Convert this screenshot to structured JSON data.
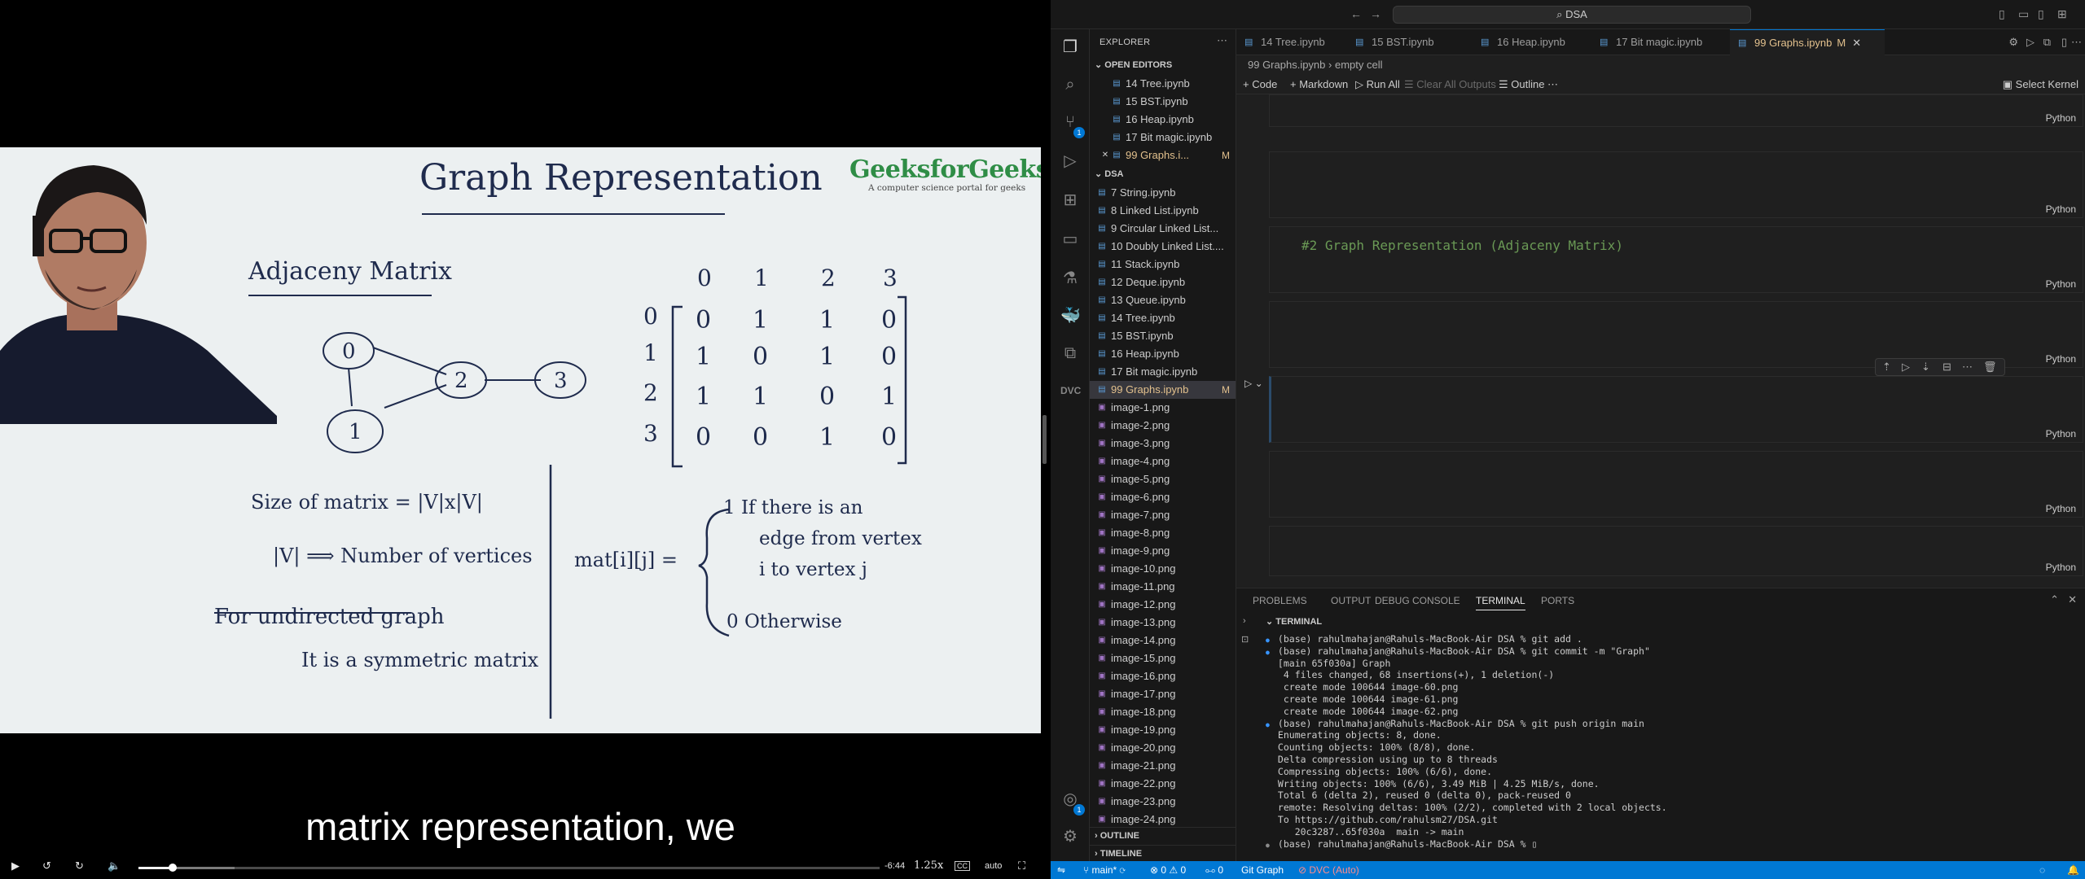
{
  "video": {
    "whiteboard": {
      "title": "Graph Representation",
      "logo": "GeeksforGeeks",
      "logo_tagline": "A computer science portal for geeks",
      "section": "Adjaceny Matrix",
      "graph_nodes": [
        "0",
        "1",
        "2",
        "3"
      ],
      "matrix_col_headers": [
        "0",
        "1",
        "2",
        "3"
      ],
      "matrix_row_headers": [
        "0",
        "1",
        "2",
        "3"
      ],
      "matrix": [
        [
          "0",
          "1",
          "1",
          "0"
        ],
        [
          "1",
          "0",
          "1",
          "0"
        ],
        [
          "1",
          "1",
          "0",
          "1"
        ],
        [
          "0",
          "0",
          "1",
          "0"
        ]
      ],
      "notes": [
        "Size of matrix = |V|x|V|",
        "|V| ⟹ Number of vertices",
        "For undirected graph",
        "It is a symmetric matrix"
      ],
      "formula_lhs": "mat[i][j] =",
      "formula_case1": [
        "1   If there is an",
        "edge from vertex",
        "i to vertex j"
      ],
      "formula_case2": "0   Otherwise"
    },
    "caption": "matrix representation, we",
    "time_remaining": "-6:44",
    "speed": "1.25x",
    "quality": "auto",
    "cc_label": "CC",
    "progress": 0.046,
    "buffered": 0.13
  },
  "vscode": {
    "search": "DSA",
    "explorer_title": "EXPLORER",
    "open_editors_title": "OPEN EDITORS",
    "open_editors": [
      {
        "name": "14 Tree.ipynb"
      },
      {
        "name": "15 BST.ipynb"
      },
      {
        "name": "16 Heap.ipynb"
      },
      {
        "name": "17 Bit magic.ipynb"
      },
      {
        "name": "99 Graphs.i...",
        "mod": "M"
      }
    ],
    "folder_title": "DSA",
    "files": [
      "7 String.ipynb",
      "8 Linked List.ipynb",
      "9 Circular Linked List...",
      "10 Doubly Linked List....",
      "11 Stack.ipynb",
      "12 Deque.ipynb",
      "13 Queue.ipynb",
      "14 Tree.ipynb",
      "15 BST.ipynb",
      "16 Heap.ipynb",
      "17 Bit magic.ipynb",
      "99 Graphs.ipynb",
      "image-1.png",
      "image-2.png",
      "image-3.png",
      "image-4.png",
      "image-5.png",
      "image-6.png",
      "image-7.png",
      "image-8.png",
      "image-9.png",
      "image-10.png",
      "image-11.png",
      "image-12.png",
      "image-13.png",
      "image-14.png",
      "image-15.png",
      "image-16.png",
      "image-17.png",
      "image-18.png",
      "image-19.png",
      "image-20.png",
      "image-21.png",
      "image-22.png",
      "image-23.png",
      "image-24.png"
    ],
    "modified_file_marker": "M",
    "outline_label": "OUTLINE",
    "timeline_label": "TIMELINE",
    "tabs": [
      "14 Tree.ipynb",
      "15 BST.ipynb",
      "16 Heap.ipynb",
      "17 Bit magic.ipynb",
      "99 Graphs.ipynb"
    ],
    "active_tab_mod": "M",
    "breadcrumb": [
      "99 Graphs.ipynb",
      "empty cell"
    ],
    "toolbar": {
      "code": "Code",
      "markdown": "Markdown",
      "run_all": "Run All",
      "clear_outputs": "Clear All Outputs",
      "outline": "Outline",
      "select_kernel": "Select Kernel"
    },
    "cell_lang": "Python",
    "markdown_cell_text": "#2 Graph Representation (Adjaceny Matrix)",
    "panel_tabs": [
      "PROBLEMS",
      "OUTPUT",
      "DEBUG CONSOLE",
      "TERMINAL",
      "PORTS"
    ],
    "terminal_title": "TERMINAL",
    "terminal_lines": [
      {
        "dot": true,
        "text": "(base) rahulmahajan@Rahuls-MacBook-Air DSA % git add ."
      },
      {
        "dot": true,
        "text": "(base) rahulmahajan@Rahuls-MacBook-Air DSA % git commit -m \"Graph\""
      },
      {
        "dot": false,
        "text": "[main 65f030a] Graph"
      },
      {
        "dot": false,
        "text": " 4 files changed, 68 insertions(+), 1 deletion(-)"
      },
      {
        "dot": false,
        "text": " create mode 100644 image-60.png"
      },
      {
        "dot": false,
        "text": " create mode 100644 image-61.png"
      },
      {
        "dot": false,
        "text": " create mode 100644 image-62.png"
      },
      {
        "dot": true,
        "text": "(base) rahulmahajan@Rahuls-MacBook-Air DSA % git push origin main"
      },
      {
        "dot": false,
        "text": "Enumerating objects: 8, done."
      },
      {
        "dot": false,
        "text": "Counting objects: 100% (8/8), done."
      },
      {
        "dot": false,
        "text": "Delta compression using up to 8 threads"
      },
      {
        "dot": false,
        "text": "Compressing objects: 100% (6/6), done."
      },
      {
        "dot": false,
        "text": "Writing objects: 100% (6/6), 3.49 MiB | 4.25 MiB/s, done."
      },
      {
        "dot": false,
        "text": "Total 6 (delta 2), reused 0 (delta 0), pack-reused 0"
      },
      {
        "dot": false,
        "text": "remote: Resolving deltas: 100% (2/2), completed with 2 local objects."
      },
      {
        "dot": false,
        "text": "To https://github.com/rahulsm27/DSA.git"
      },
      {
        "dot": false,
        "text": "   20c3287..65f030a  main -> main"
      },
      {
        "dot": "grey",
        "text": "(base) rahulmahajan@Rahuls-MacBook-Air DSA % ▯"
      }
    ],
    "status": {
      "branch": "main*",
      "errors": "0",
      "warnings": "0",
      "ports": "0",
      "git_graph": "Git Graph",
      "dvc": "DVC (Auto)"
    },
    "colors": {
      "accent": "#0078d4",
      "modified": "#e2c08d",
      "markdown_green": "#6a9955"
    }
  }
}
